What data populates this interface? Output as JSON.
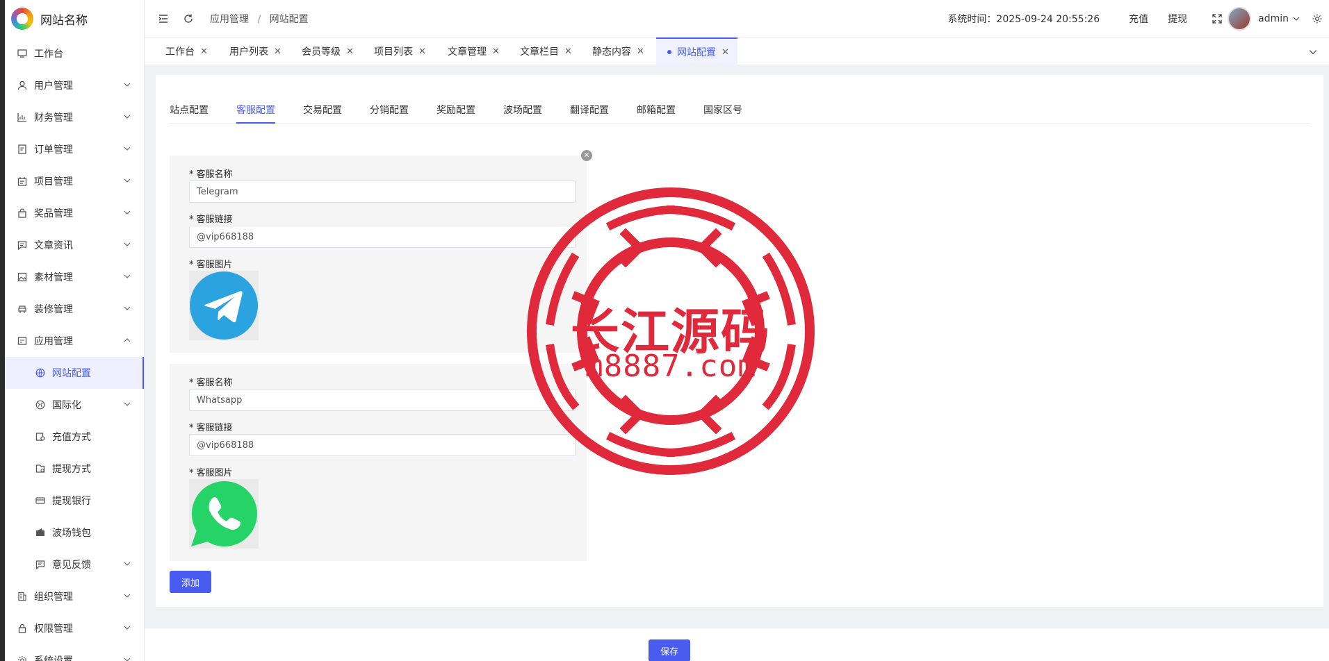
{
  "brand": {
    "name": "网站名称"
  },
  "sidebar": {
    "items": [
      {
        "label": "工作台",
        "icon": "monitor-icon",
        "has_children": false
      },
      {
        "label": "用户管理",
        "icon": "user-icon",
        "has_children": true
      },
      {
        "label": "财务管理",
        "icon": "chart-icon",
        "has_children": true
      },
      {
        "label": "订单管理",
        "icon": "order-icon",
        "has_children": true
      },
      {
        "label": "项目管理",
        "icon": "project-icon",
        "has_children": true
      },
      {
        "label": "奖品管理",
        "icon": "bag-icon",
        "has_children": true
      },
      {
        "label": "文章资讯",
        "icon": "message-icon",
        "has_children": true
      },
      {
        "label": "素材管理",
        "icon": "image-icon",
        "has_children": true
      },
      {
        "label": "装修管理",
        "icon": "decorate-icon",
        "has_children": true
      },
      {
        "label": "应用管理",
        "icon": "app-icon",
        "has_children": true,
        "expanded": true
      },
      {
        "label": "网站配置",
        "icon": "globe-icon",
        "sub": true,
        "active": true
      },
      {
        "label": "国际化",
        "icon": "globe2-icon",
        "sub": true,
        "has_children": true
      },
      {
        "label": "充值方式",
        "icon": "recharge-icon",
        "sub": true
      },
      {
        "label": "提现方式",
        "icon": "withdraw-icon",
        "sub": true
      },
      {
        "label": "提现银行",
        "icon": "card-icon",
        "sub": true
      },
      {
        "label": "波场钱包",
        "icon": "wallet-icon",
        "sub": true
      },
      {
        "label": "意见反馈",
        "icon": "feedback-icon",
        "sub": true,
        "has_children": true
      },
      {
        "label": "组织管理",
        "icon": "building-icon",
        "has_children": true
      },
      {
        "label": "权限管理",
        "icon": "lock-icon",
        "has_children": true
      },
      {
        "label": "系统设置",
        "icon": "settings-icon",
        "has_children": true
      }
    ]
  },
  "header": {
    "breadcrumb": [
      "应用管理",
      "网站配置"
    ],
    "sys_time_label": "系统时间：",
    "sys_time": "2025-09-24 20:55:26",
    "recharge": "充值",
    "withdraw": "提现",
    "username": "admin"
  },
  "tabs": [
    {
      "label": "工作台"
    },
    {
      "label": "用户列表"
    },
    {
      "label": "会员等级"
    },
    {
      "label": "项目列表"
    },
    {
      "label": "文章管理"
    },
    {
      "label": "文章栏目"
    },
    {
      "label": "静态内容"
    },
    {
      "label": "网站配置",
      "active": true
    }
  ],
  "config_tabs": [
    "站点配置",
    "客服配置",
    "交易配置",
    "分销配置",
    "奖励配置",
    "波场配置",
    "翻译配置",
    "邮箱配置",
    "国家区号"
  ],
  "config_tab_active": "客服配置",
  "services": [
    {
      "name_label": "客服名称",
      "name_value": "Telegram",
      "link_label": "客服链接",
      "link_value": "@vip668188",
      "image_label": "客服图片",
      "image_icon": "telegram-icon",
      "image_color": "#2aa3e0"
    },
    {
      "name_label": "客服名称",
      "name_value": "Whatsapp",
      "link_label": "客服链接",
      "link_value": "@vip668188",
      "image_label": "客服图片",
      "image_icon": "whatsapp-icon",
      "image_color": "#25d366"
    }
  ],
  "required_mark": "*",
  "add_button": "添加",
  "save_button": "保存",
  "watermark": {
    "line1": "长江源码",
    "line2": "m8887.com",
    "color": "#e0293a"
  },
  "colors": {
    "accent": "#4a5cf0"
  }
}
